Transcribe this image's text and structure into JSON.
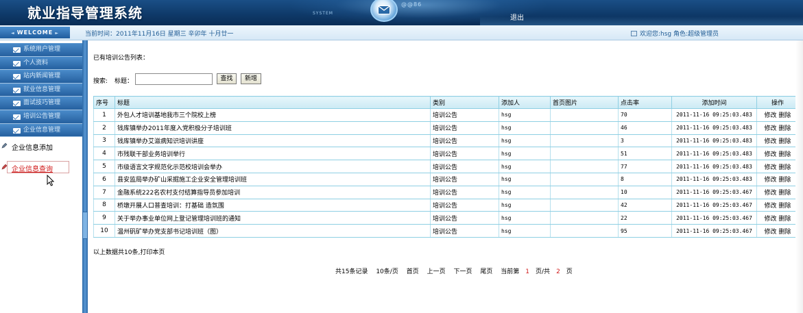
{
  "header": {
    "app_title": "就业指导管理系统",
    "system_text": "SYSTEM",
    "brand_mark": "@@86",
    "logout": "退出"
  },
  "statusbar": {
    "welcome": "WELCOME",
    "current_time": "当前时间：2011年11月16日 星期三 辛卯年 十月廿一",
    "user_info": "欢迎您:hsg 角色:超级管理员"
  },
  "sidebar": {
    "menu": [
      {
        "label": "系统用户管理"
      },
      {
        "label": "个人资料"
      },
      {
        "label": "站内新闻管理"
      },
      {
        "label": "就业信息管理"
      },
      {
        "label": "面试技巧管理"
      },
      {
        "label": "培训公告管理"
      },
      {
        "label": "企业信息管理"
      }
    ],
    "sub_items": [
      {
        "label": "企业信息添加"
      },
      {
        "label": "企业信息查询"
      }
    ]
  },
  "main": {
    "list_heading": "已有培训公告列表：",
    "search": {
      "label_search": "搜索:",
      "label_title": "标题：",
      "value": "",
      "btn_search": "查找",
      "btn_add": "新增"
    },
    "table": {
      "columns": [
        "序号",
        "标题",
        "类别",
        "添加人",
        "首页图片",
        "点击率",
        "添加时间",
        "操作"
      ],
      "rows": [
        {
          "no": "1",
          "title": "外包人才培训基地我市三个院校上榜",
          "category": "培训公告",
          "adder": "hsg",
          "image": "",
          "clicks": "70",
          "time": "2011-11-16 09:25:03.483"
        },
        {
          "no": "2",
          "title": "钱库镇举办2011年度入党积极分子培训班",
          "category": "培训公告",
          "adder": "hsg",
          "image": "",
          "clicks": "46",
          "time": "2011-11-16 09:25:03.483"
        },
        {
          "no": "3",
          "title": "钱库镇举办艾滋病知识培训讲座",
          "category": "培训公告",
          "adder": "hsg",
          "image": "",
          "clicks": "3",
          "time": "2011-11-16 09:25:03.483"
        },
        {
          "no": "4",
          "title": "市残联干部业务培训举行",
          "category": "培训公告",
          "adder": "hsg",
          "image": "",
          "clicks": "51",
          "time": "2011-11-16 09:25:03.483"
        },
        {
          "no": "5",
          "title": "市级语言文字规范化示范校培训会举办",
          "category": "培训公告",
          "adder": "hsg",
          "image": "",
          "clicks": "77",
          "time": "2011-11-16 09:25:03.483"
        },
        {
          "no": "6",
          "title": "县安监局举办矿山采掘施工企业安全管理培训班",
          "category": "培训公告",
          "adder": "hsg",
          "image": "",
          "clicks": "8",
          "time": "2011-11-16 09:25:03.483"
        },
        {
          "no": "7",
          "title": "金融系统222名农村支付结算指导员参加培训",
          "category": "培训公告",
          "adder": "hsg",
          "image": "",
          "clicks": "10",
          "time": "2011-11-16 09:25:03.467"
        },
        {
          "no": "8",
          "title": "桥墩开展人口普查培训：打基础 造氛围",
          "category": "培训公告",
          "adder": "hsg",
          "image": "",
          "clicks": "42",
          "time": "2011-11-16 09:25:03.467"
        },
        {
          "no": "9",
          "title": "关于举办事业单位网上登记管理培训班的通知",
          "category": "培训公告",
          "adder": "hsg",
          "image": "",
          "clicks": "22",
          "time": "2011-11-16 09:25:03.467"
        },
        {
          "no": "10",
          "title": "温州矾矿举办党支部书记培训班（图）",
          "category": "培训公告",
          "adder": "hsg",
          "image": "",
          "clicks": "95",
          "time": "2011-11-16 09:25:03.467"
        }
      ],
      "op_edit": "修改",
      "op_delete": "删除"
    },
    "footer_note": "以上数据共10条,打印本页",
    "pager": {
      "total": "共15条记录",
      "per_page": "10条/页",
      "first": "首页",
      "prev": "上一页",
      "next": "下一页",
      "last": "尾页",
      "current_prefix": "当前第",
      "current_page": "1",
      "current_mid": "页/共",
      "total_pages": "2",
      "current_suffix": "页"
    }
  },
  "colors": {
    "banner": "#0f3a6a",
    "menu_blue": "#25609f",
    "table_border": "#8ecfe3",
    "active_red": "#d01818"
  }
}
